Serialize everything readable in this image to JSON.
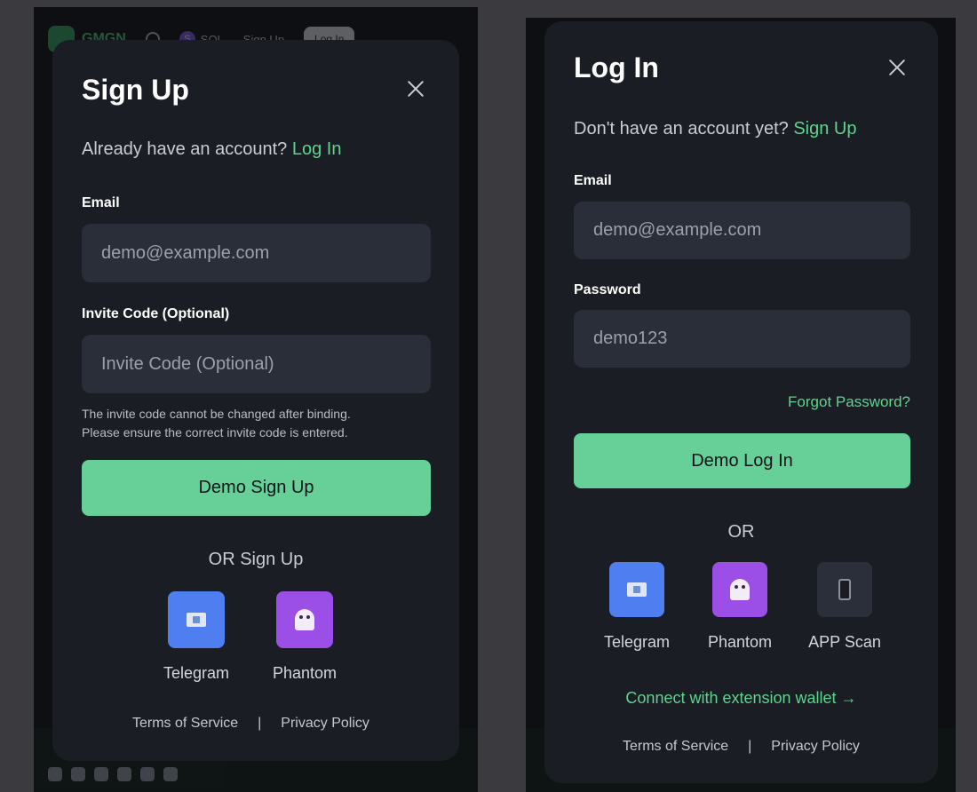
{
  "background_app": {
    "brand": "GMGN",
    "chain": "SOL",
    "chain_badge": "S",
    "sign_up": "Sign Up",
    "log_in": "Log In"
  },
  "signup_modal": {
    "title": "Sign Up",
    "switch_prompt": "Already have an account?",
    "switch_link": "Log In",
    "email_label": "Email",
    "email_placeholder": "demo@example.com",
    "invite_label": "Invite Code (Optional)",
    "invite_placeholder": "Invite Code (Optional)",
    "hint_line1": "The invite code cannot be changed after binding.",
    "hint_line2": "Please ensure the correct invite code is entered.",
    "primary_button": "Demo Sign Up",
    "or_text": "OR Sign Up",
    "providers": [
      {
        "name": "Telegram",
        "icon": "envelope-icon"
      },
      {
        "name": "Phantom",
        "icon": "ghost-icon"
      }
    ],
    "terms": "Terms of Service",
    "separator": "|",
    "privacy": "Privacy Policy"
  },
  "login_modal": {
    "title": "Log In",
    "switch_prompt": "Don't have an account yet?",
    "switch_link": "Sign Up",
    "email_label": "Email",
    "email_value": "demo@example.com",
    "password_label": "Password",
    "password_value": "demo123",
    "forgot": "Forgot Password?",
    "primary_button": "Demo Log In",
    "or_text": "OR",
    "providers": [
      {
        "name": "Telegram",
        "icon": "envelope-icon"
      },
      {
        "name": "Phantom",
        "icon": "ghost-icon"
      },
      {
        "name": "APP Scan",
        "icon": "phone-icon"
      }
    ],
    "extension_link": "Connect with extension wallet →",
    "terms": "Terms of Service",
    "separator": "|",
    "privacy": "Privacy Policy"
  },
  "colors": {
    "accent": "#5fd48f",
    "primary_button": "#67cf98",
    "modal_bg": "#1a1d23",
    "input_bg": "#2a2e38",
    "telegram": "#4f7ef0",
    "phantom": "#9b4fe6"
  }
}
